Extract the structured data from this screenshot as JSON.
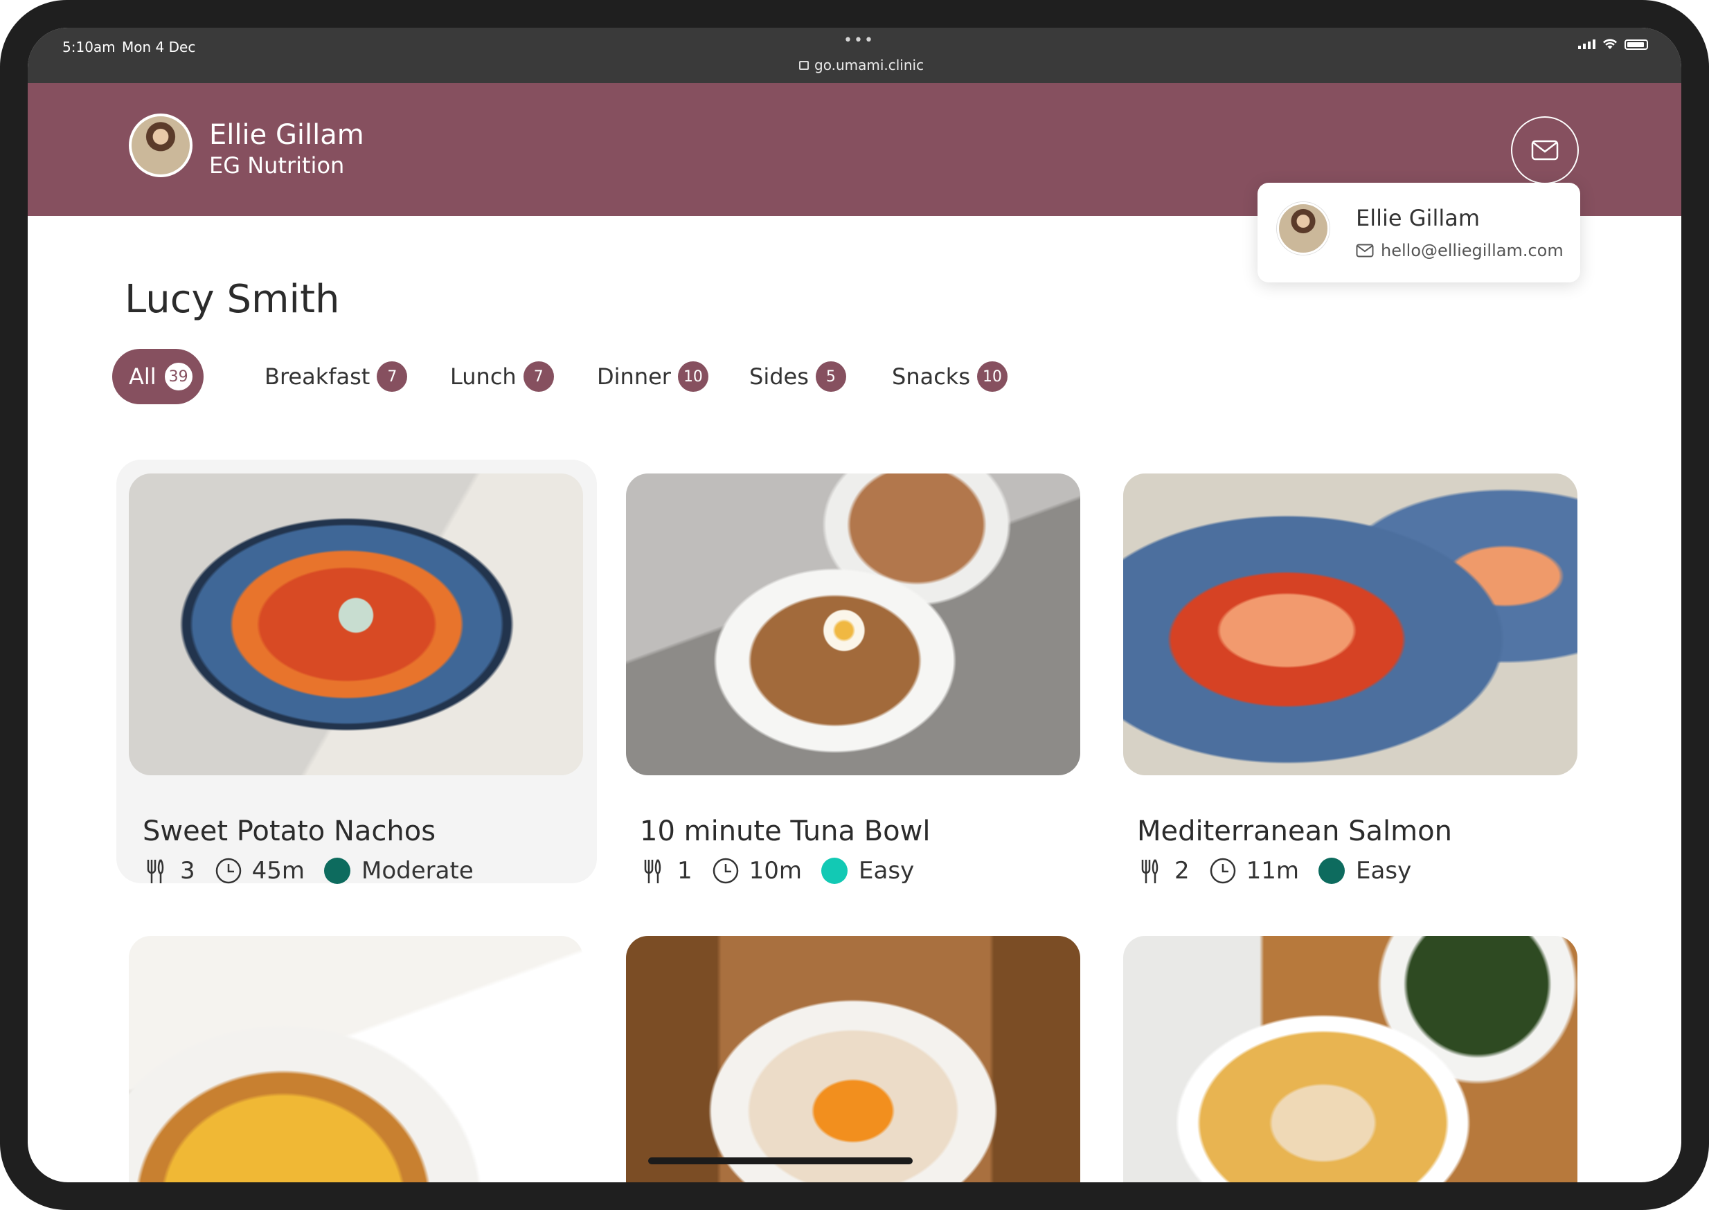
{
  "status_bar": {
    "time": "5:10am",
    "date": "Mon 4 Dec",
    "dots": "•••",
    "url": "go.umami.clinic"
  },
  "header": {
    "coach_name": "Ellie Gillam",
    "business": "EG Nutrition",
    "mail_icon": "envelope-icon"
  },
  "popover": {
    "name": "Ellie Gillam",
    "email": "hello@elliegillam.com"
  },
  "client": {
    "name": "Lucy Smith"
  },
  "tabs": [
    {
      "label": "All",
      "count": "39",
      "active": true
    },
    {
      "label": "Breakfast",
      "count": "7"
    },
    {
      "label": "Lunch",
      "count": "7"
    },
    {
      "label": "Dinner",
      "count": "10"
    },
    {
      "label": "Sides",
      "count": "5"
    },
    {
      "label": "Snacks",
      "count": "10"
    }
  ],
  "recipes": [
    {
      "title": "Sweet Potato Nachos",
      "servings": "3",
      "time": "45m",
      "difficulty": "Moderate",
      "difficulty_color": "#0d6b5e"
    },
    {
      "title": "10 minute Tuna Bowl",
      "servings": "1",
      "time": "10m",
      "difficulty": "Easy",
      "difficulty_color": "#12c9b4"
    },
    {
      "title": "Mediterranean Salmon",
      "servings": "2",
      "time": "11m",
      "difficulty": "Easy",
      "difficulty_color": "#0d6b5e"
    }
  ],
  "colors": {
    "brand": "#86505f",
    "status_bar": "#3a3a3a"
  }
}
